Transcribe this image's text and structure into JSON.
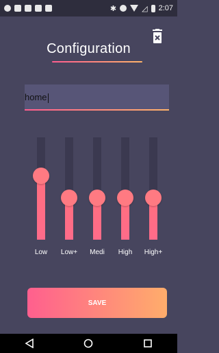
{
  "status_bar": {
    "time": "2:07",
    "icons": [
      "notification-icon",
      "usb-icon",
      "image-icon",
      "image-icon",
      "keyboard-icon",
      "bluetooth-icon",
      "do-not-disturb-icon",
      "wifi-icon",
      "signal-icon",
      "battery-icon"
    ]
  },
  "header": {
    "title": "Configuration",
    "delete_icon": "trash-icon"
  },
  "profile": {
    "name_value": "home",
    "placeholder": ""
  },
  "equalizer": {
    "bands": [
      {
        "label": "Low",
        "level": 0.72
      },
      {
        "label": "Low+",
        "level": 0.47
      },
      {
        "label": "Medi",
        "level": 0.47
      },
      {
        "label": "High",
        "level": 0.47
      },
      {
        "label": "High+",
        "level": 0.47
      }
    ]
  },
  "actions": {
    "save_label": "SAVE"
  },
  "colors": {
    "background": "#47455e",
    "accent_start": "#ff5f8e",
    "accent_end": "#ffad6b",
    "track": "#3b3950",
    "input_bg": "#575577"
  },
  "nav_bar": {
    "buttons": [
      "back-icon",
      "home-icon",
      "recents-icon"
    ]
  }
}
